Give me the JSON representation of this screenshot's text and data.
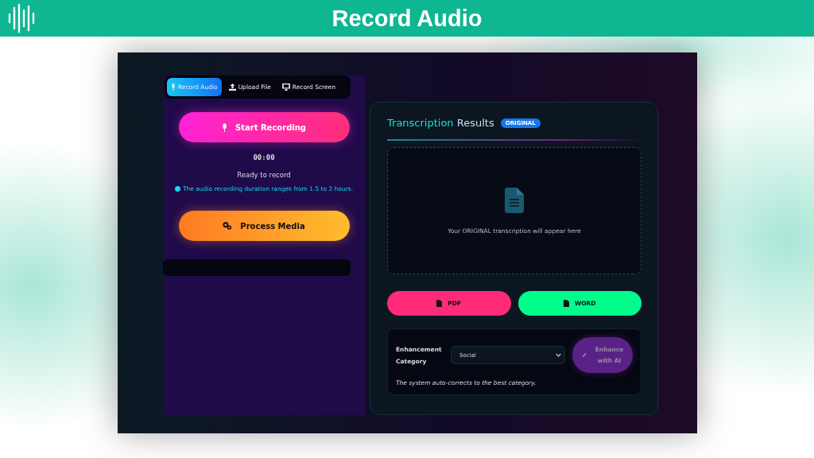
{
  "header": {
    "title": "Record Audio"
  },
  "tabs": [
    {
      "label": "Record Audio",
      "kind": "mic",
      "selected": true
    },
    {
      "label": "Upload File",
      "kind": "upload",
      "selected": false
    },
    {
      "label": "Record Screen",
      "kind": "monitor",
      "selected": false
    }
  ],
  "recorder": {
    "start_button": "Start Recording",
    "timer": "00:00",
    "status": "Ready to record",
    "note": "The audio recording duration ranges from 1.5 to 2 hours.",
    "process_button": "Process Media"
  },
  "results": {
    "title_accent": "Transcription",
    "title_rest": "Results",
    "badge": "ORIGINAL",
    "empty_message": "Your ORIGINAL transcription will appear here"
  },
  "export_buttons": [
    {
      "label": "PDF",
      "kind": "pdf"
    },
    {
      "label": "WORD",
      "kind": "word"
    }
  ],
  "enhancement": {
    "label": "Enhancement Category",
    "value": "Social",
    "button": "Enhance with AI",
    "note": "The system auto-corrects to the best category."
  }
}
